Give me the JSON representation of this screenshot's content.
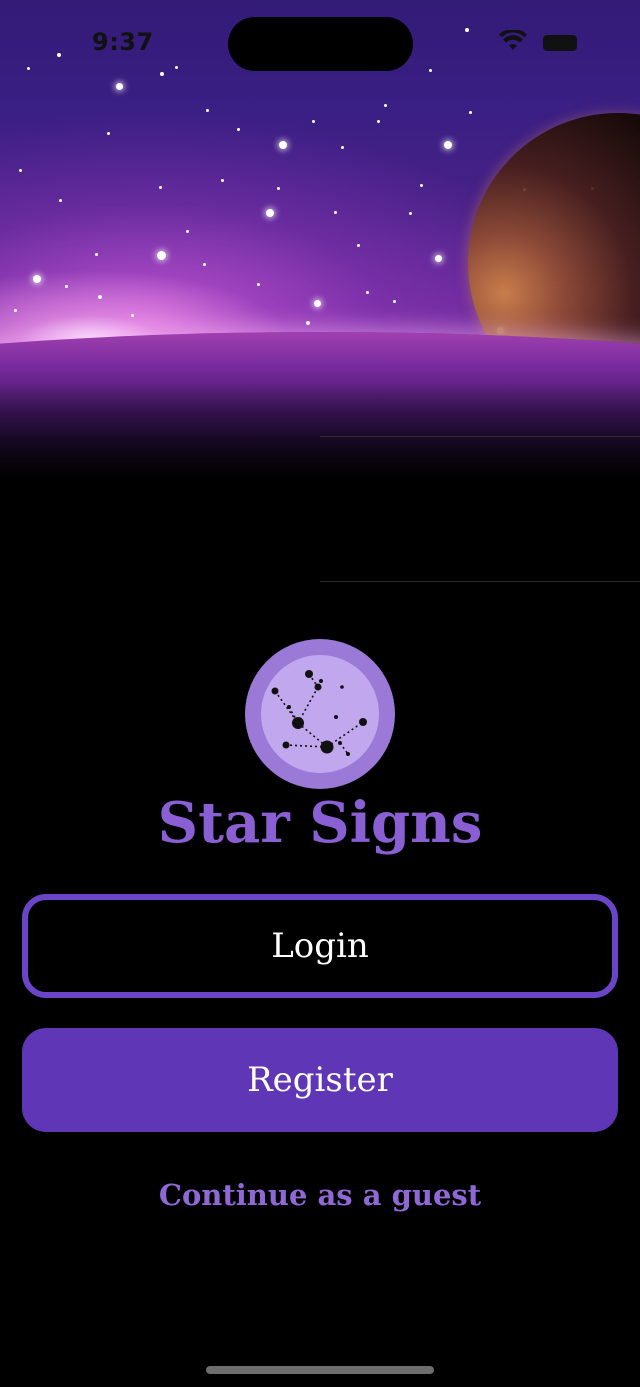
{
  "status_bar": {
    "time": "9:37",
    "wifi_icon": "wifi-icon",
    "battery_icon": "battery-icon"
  },
  "background": {
    "image": "space-horizon-illustration",
    "colors": {
      "sky_top": "#2e1468",
      "sky_glow": "#d05fe0",
      "planet": "#c9823f"
    }
  },
  "logo": {
    "icon": "constellation-icon",
    "outer_color": "#9b79d6",
    "inner_color": "#c1a8ee"
  },
  "app": {
    "title": "Star Signs"
  },
  "actions": {
    "login_label": "Login",
    "register_label": "Register",
    "guest_label": "Continue as a guest"
  },
  "colors": {
    "accent": "#6a45c8",
    "accent_fill": "#5f37b6",
    "title": "#8b5fd4",
    "link": "#9068d6"
  }
}
